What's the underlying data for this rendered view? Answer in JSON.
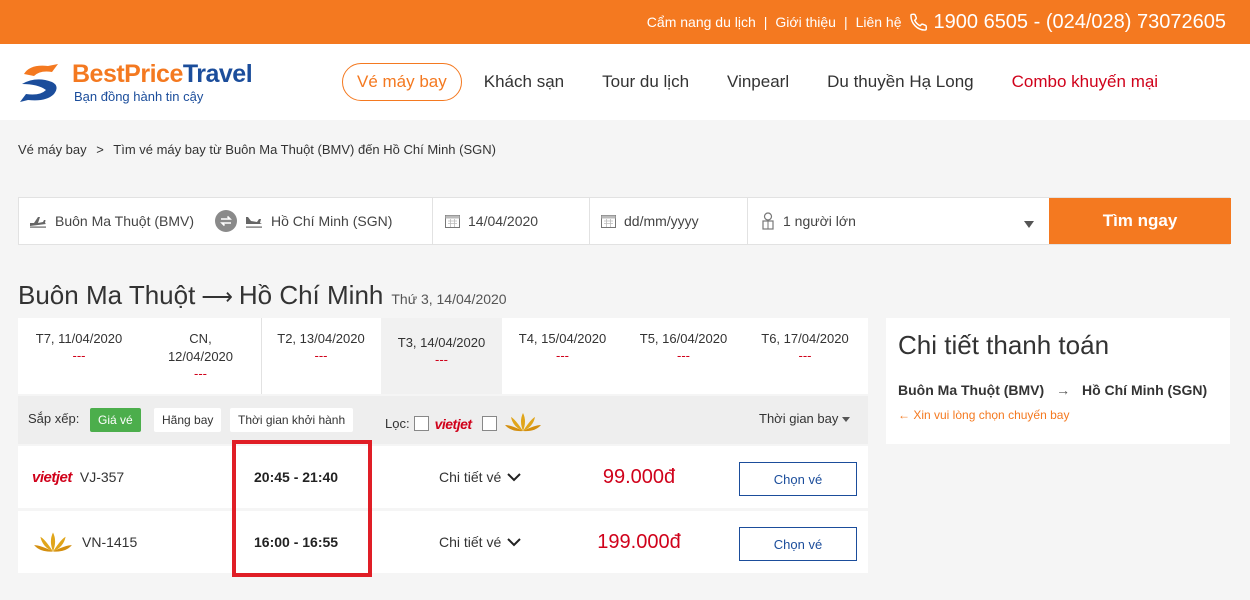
{
  "topbar": {
    "links": [
      "Cẩm nang du lịch",
      "Giới thiệu",
      "Liên hệ"
    ],
    "separator": "|",
    "phone": "1900 6505 - (024/028) 73072605"
  },
  "logo": {
    "brand_a": "BestPrice",
    "brand_b": "Travel",
    "tagline": "Bạn đồng hành tin cậy"
  },
  "nav": {
    "items": [
      "Vé máy bay",
      "Khách sạn",
      "Tour du lịch",
      "Vinpearl",
      "Du thuyền Hạ Long",
      "Combo khuyến mại"
    ],
    "active_index": 0
  },
  "breadcrumb": {
    "home": "Vé máy bay",
    "arrow": ">",
    "current": "Tìm vé máy bay từ Buôn Ma Thuột (BMV) đến Hồ Chí Minh (SGN)"
  },
  "search": {
    "from": "Buôn Ma Thuột (BMV)",
    "to": "Hồ Chí Minh (SGN)",
    "depart_date": "14/04/2020",
    "return_placeholder": "dd/mm/yyyy",
    "passengers": "1 người lớn",
    "button": "Tìm ngay"
  },
  "route": {
    "from": "Buôn Ma Thuột",
    "arrow": "⟶",
    "to": "Hồ Chí Minh",
    "date": "Thứ 3, 14/04/2020"
  },
  "date_tabs": [
    {
      "line1": "T7, 11/04/2020",
      "line2": "",
      "price": "---"
    },
    {
      "line1": "CN,",
      "line2": "12/04/2020",
      "price": "---"
    },
    {
      "line1": "T2, 13/04/2020",
      "line2": "",
      "price": "---"
    },
    {
      "line1": "T3, 14/04/2020",
      "line2": "",
      "price": "---"
    },
    {
      "line1": "T4, 15/04/2020",
      "line2": "",
      "price": "---"
    },
    {
      "line1": "T5, 16/04/2020",
      "line2": "",
      "price": "---"
    },
    {
      "line1": "T6, 17/04/2020",
      "line2": "",
      "price": "---"
    }
  ],
  "active_date_index": 3,
  "sort": {
    "label": "Sắp xếp:",
    "options": [
      "Giá vé",
      "Hãng bay",
      "Thời gian khởi hành"
    ],
    "active_index": 0,
    "filter_label": "Lọc:",
    "vietjet_logo": "vietjet",
    "flight_time": "Thời gian bay"
  },
  "flights": [
    {
      "airline_logo": "vietjet",
      "code": "VJ-357",
      "time": "20:45 - 21:40",
      "detail": "Chi tiết vé",
      "price": "99.000đ",
      "button": "Chọn vé"
    },
    {
      "airline_logo": "lotus",
      "code": "VN-1415",
      "time": "16:00 - 16:55",
      "detail": "Chi tiết vé",
      "price": "199.000đ",
      "button": "Chọn vé"
    }
  ],
  "summary": {
    "title": "Chi tiết thanh toán",
    "from": "Buôn Ma Thuột (BMV)",
    "arrow": "→",
    "to": "Hồ Chí Minh (SGN)",
    "hint": "← Xin vui lòng chọn chuyến bay"
  },
  "colors": {
    "brand_orange": "#f47920",
    "brand_blue": "#1b4d9b",
    "price_red": "#d0021b",
    "highlight_red": "#e01e26",
    "sort_green": "#4cae4c"
  }
}
